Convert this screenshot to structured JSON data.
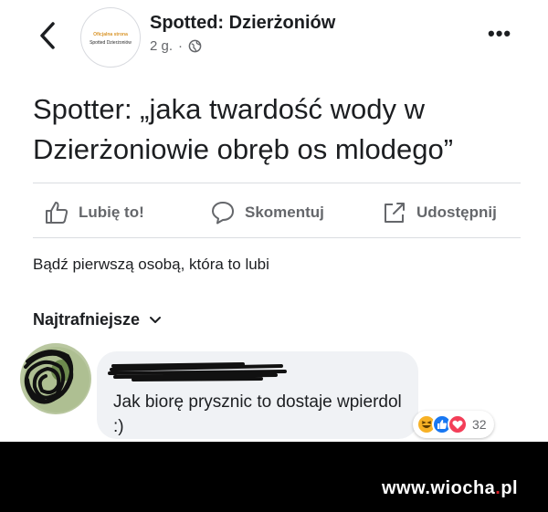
{
  "page": {
    "name": "Spotted: Dzierżoniów",
    "time": "2 g.",
    "separator": "·",
    "avatar_line1": "Oficjalna strona",
    "avatar_line2": "Spotted Dzierżoniów"
  },
  "post": {
    "text": "Spotter: „jaka twardość wody w Dzierżoniowie obręb os mlodego”"
  },
  "actions": {
    "like": "Lubię to!",
    "comment": "Skomentuj",
    "share": "Udostępnij"
  },
  "likes_text": "Bądź pierwszą osobą, która to lubi",
  "comments": {
    "sort_label": "Najtrafniejsze",
    "items": [
      {
        "author": "",
        "text": "Jak biorę prysznic to dostaje wpierdol :)",
        "reaction_count": "32",
        "reactions": [
          "haha-icon",
          "like-icon",
          "love-icon"
        ]
      }
    ]
  },
  "watermark": {
    "part1": "www.wiocha",
    "dot": ".",
    "part2": "pl"
  },
  "colors": {
    "text": "#1c1e21",
    "secondary": "#65676b",
    "bubble": "#f0f2f5",
    "like_blue": "#1877f2",
    "love_red": "#f33e58",
    "haha_yellow": "#f7b125"
  }
}
